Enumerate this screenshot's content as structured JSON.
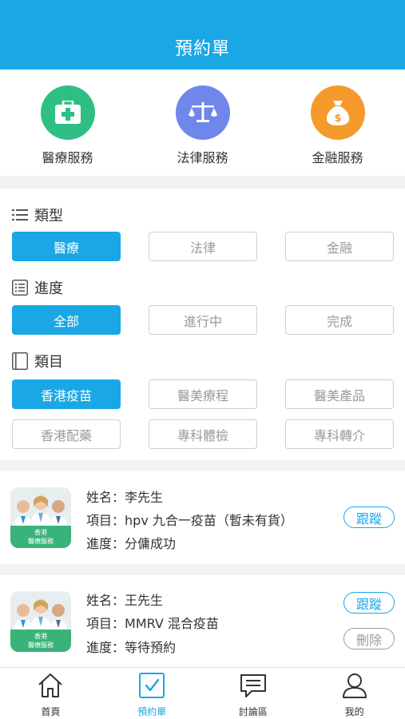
{
  "header": {
    "title": "預約單"
  },
  "services": [
    {
      "label": "醫療服務",
      "icon": "medical-kit-icon",
      "color": "#2fbf84"
    },
    {
      "label": "法律服務",
      "icon": "scales-icon",
      "color": "#6f86ea"
    },
    {
      "label": "金融服務",
      "icon": "money-bag-icon",
      "color": "#f59a2b"
    }
  ],
  "filters": {
    "type": {
      "title": "類型",
      "options": [
        "醫療",
        "法律",
        "金融"
      ],
      "selected": "醫療"
    },
    "progress": {
      "title": "進度",
      "options": [
        "全部",
        "進行中",
        "完成"
      ],
      "selected": "全部"
    },
    "category": {
      "title": "類目",
      "options": [
        "香港疫苗",
        "醫美療程",
        "醫美產品",
        "香港配藥",
        "專科體檢",
        "專科轉介"
      ],
      "selected": "香港疫苗"
    }
  },
  "orders": [
    {
      "avatar_caption": [
        "香港",
        "醫療服務"
      ],
      "name_label": "姓名：",
      "name": "李先生",
      "item_label": "項目：",
      "item": "hpv 九合一疫苗（暫未有貨）",
      "progress_label": "進度：",
      "progress": "分傭成功",
      "follow_label": "跟蹤"
    },
    {
      "avatar_caption": [
        "香港",
        "醫療服務"
      ],
      "name_label": "姓名：",
      "name": "王先生",
      "item_label": "項目：",
      "item": "MMRV 混合疫苗",
      "progress_label": "進度：",
      "progress": "等待預約",
      "follow_label": "跟蹤",
      "delete_label": "刪除"
    }
  ],
  "tabbar": [
    {
      "label": "首頁",
      "icon": "home-icon"
    },
    {
      "label": "預約單",
      "icon": "checkbox-icon",
      "active": true
    },
    {
      "label": "討論區",
      "icon": "chat-icon"
    },
    {
      "label": "我的",
      "icon": "user-icon"
    }
  ],
  "colors": {
    "primary": "#1aa7e6",
    "green": "#2fbf84",
    "purple": "#6f86ea",
    "orange": "#f59a2b"
  }
}
